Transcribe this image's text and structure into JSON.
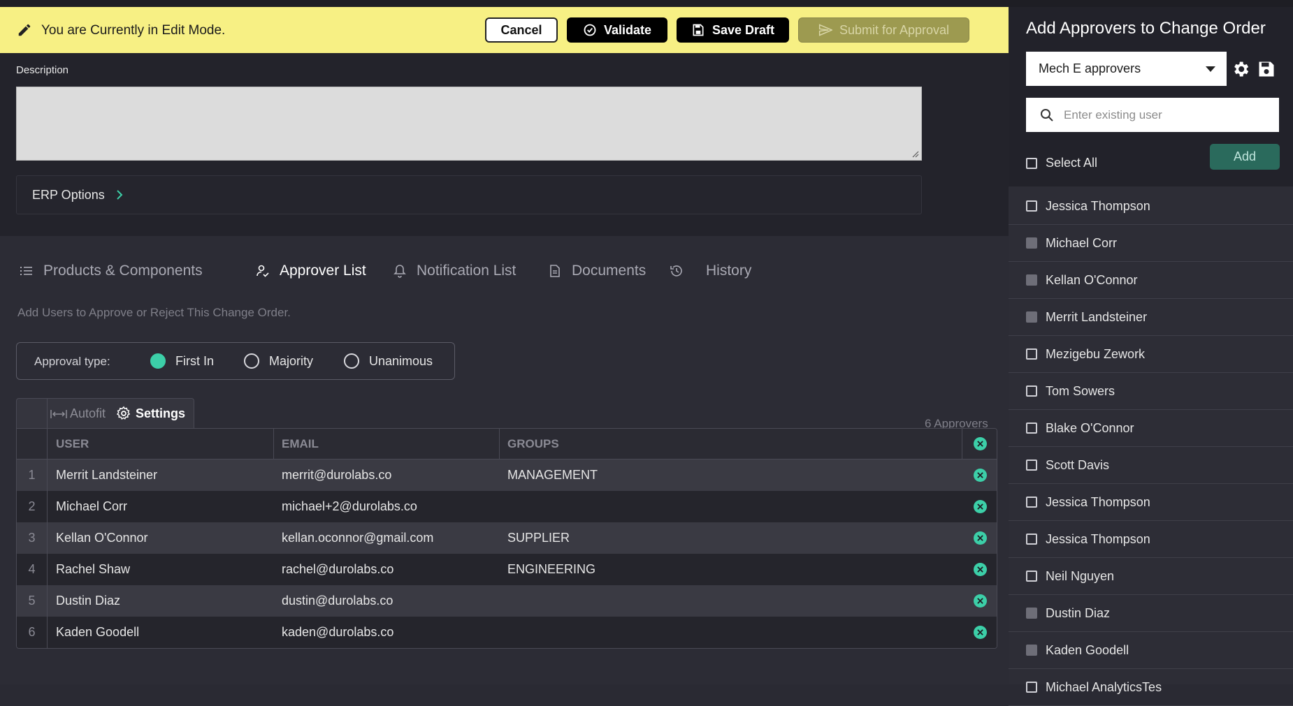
{
  "edit_bar": {
    "message": "You are Currently in Edit Mode.",
    "cancel_label": "Cancel",
    "validate_label": "Validate",
    "save_draft_label": "Save Draft",
    "submit_label": "Submit for Approval"
  },
  "description": {
    "label": "Description",
    "value": ""
  },
  "erp": {
    "label": "ERP Options"
  },
  "tabs": [
    {
      "label": "Products & Components",
      "icon": "list-icon",
      "active": false
    },
    {
      "label": "Approver List",
      "icon": "user-check-icon",
      "active": true
    },
    {
      "label": "Notification List",
      "icon": "bell-icon",
      "active": false
    },
    {
      "label": "Documents",
      "icon": "document-icon",
      "active": false
    },
    {
      "label": "History",
      "icon": "history-icon",
      "active": false
    }
  ],
  "approver_section": {
    "subtitle": "Add Users to Approve or Reject This Change Order.",
    "approval_type_label": "Approval type:",
    "options": [
      "First In",
      "Majority",
      "Unanimous"
    ],
    "selected": "First In"
  },
  "grid": {
    "autofit_label": "Autofit",
    "settings_label": "Settings",
    "count_label": "6 Approvers",
    "columns": [
      "USER",
      "EMAIL",
      "GROUPS"
    ],
    "rows": [
      {
        "num": "1",
        "user": "Merrit Landsteiner",
        "email": "merrit@durolabs.co",
        "groups": "MANAGEMENT"
      },
      {
        "num": "2",
        "user": "Michael Corr",
        "email": "michael+2@durolabs.co",
        "groups": ""
      },
      {
        "num": "3",
        "user": "Kellan O'Connor",
        "email": "kellan.oconnor@gmail.com",
        "groups": "SUPPLIER"
      },
      {
        "num": "4",
        "user": "Rachel Shaw",
        "email": "rachel@durolabs.co",
        "groups": "ENGINEERING"
      },
      {
        "num": "5",
        "user": "Dustin Diaz",
        "email": "dustin@durolabs.co",
        "groups": ""
      },
      {
        "num": "6",
        "user": "Kaden Goodell",
        "email": "kaden@durolabs.co",
        "groups": ""
      }
    ]
  },
  "side_panel": {
    "title": "Add Approvers to Change Order",
    "template_value": "Mech E approvers",
    "search_placeholder": "Enter existing user",
    "select_all_label": "Select All",
    "add_label": "Add",
    "users": [
      {
        "name": "Jessica Thompson",
        "disabled": false
      },
      {
        "name": "Michael Corr",
        "disabled": true
      },
      {
        "name": "Kellan O'Connor",
        "disabled": true
      },
      {
        "name": "Merrit Landsteiner",
        "disabled": true
      },
      {
        "name": "Mezigebu Zework",
        "disabled": false
      },
      {
        "name": "Tom Sowers",
        "disabled": false
      },
      {
        "name": "Blake O'Connor",
        "disabled": false
      },
      {
        "name": "Scott Davis",
        "disabled": false
      },
      {
        "name": "Jessica Thompson",
        "disabled": false
      },
      {
        "name": "Jessica Thompson",
        "disabled": false
      },
      {
        "name": "Neil Nguyen",
        "disabled": false
      },
      {
        "name": "Dustin Diaz",
        "disabled": true
      },
      {
        "name": "Kaden Goodell",
        "disabled": true
      },
      {
        "name": "Michael AnalyticsTes",
        "disabled": false
      }
    ]
  },
  "colors": {
    "accent": "#3ccfa8",
    "edit_bar": "#f7f084",
    "background": "#2c2c35"
  }
}
